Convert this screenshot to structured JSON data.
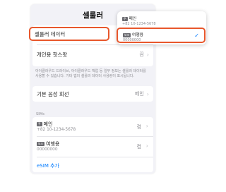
{
  "page_title": "셀룰러",
  "rows": {
    "cellular_data": "셀룰러 데이터",
    "hotspot": "개인용 핫스팟",
    "hotspot_value": "끔",
    "hotspot_description": "아이클라우드 드라이브, 아이클라우드 백업 등 일부 정보는 셀룰러 데이터를 사용할 수 있습니다. 기타 앱의 셀룰러 데이터 사용량이 표시됩니다.",
    "default_voice": "기본 음성 회선",
    "default_voice_value": "메인"
  },
  "sims": {
    "header": "SIMs",
    "items": [
      {
        "badge": "주",
        "name": "메인",
        "number": "+82 10-1234-5678",
        "status": "켬"
      },
      {
        "badge": "보조",
        "name": "여행용",
        "number": "00000000",
        "status": "켬"
      }
    ],
    "add_esim": "eSIM 추가"
  },
  "popup": {
    "items": [
      {
        "badge": "주",
        "name": "메인",
        "number": "+82 10-1234-5678",
        "selected": false
      },
      {
        "badge": "보조",
        "name": "여행용",
        "number": "00000000",
        "selected": true
      }
    ]
  },
  "colors": {
    "highlight": "#e8572c",
    "accent": "#007aff",
    "panel_bg": "#f2f2f7"
  }
}
